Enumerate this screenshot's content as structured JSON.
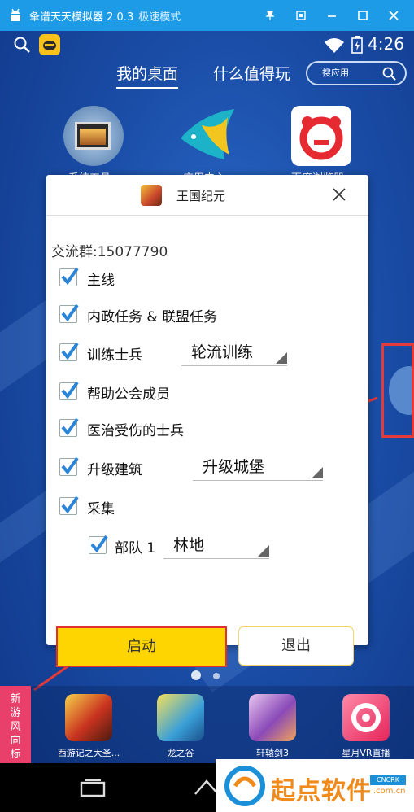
{
  "window": {
    "title": "夆谱天天模拟器 2.0.3",
    "mode": "极速模式",
    "controls": [
      "pin-icon",
      "restore-icon",
      "minimize-icon",
      "maximize-icon",
      "close-icon"
    ]
  },
  "statusbar": {
    "time": "4:26"
  },
  "tabs": [
    {
      "label": "我的桌面",
      "active": true
    },
    {
      "label": "什么值得玩",
      "active": false
    }
  ],
  "search": {
    "placeholder": "搜应用"
  },
  "desktop_apps": [
    {
      "label": "系统工具"
    },
    {
      "label": "应用中心"
    },
    {
      "label": "百度浏览器"
    }
  ],
  "dialog": {
    "title": "王国纪元",
    "group": "交流群:15077790",
    "options": [
      {
        "label": "主线",
        "checked": true
      },
      {
        "label": "内政任务 & 联盟任务",
        "checked": true
      },
      {
        "label": "训练士兵",
        "checked": true,
        "select": "轮流训练"
      },
      {
        "label": "帮助公会成员",
        "checked": true
      },
      {
        "label": "医治受伤的士兵",
        "checked": true
      },
      {
        "label": "升级建筑",
        "checked": true,
        "select": "升级城堡"
      },
      {
        "label": "采集",
        "checked": true
      }
    ],
    "sub_option": {
      "label": "部队 1",
      "checked": true,
      "select": "林地"
    },
    "start": "启动",
    "exit": "退出"
  },
  "dock": {
    "new_game_label": "新游风向标",
    "apps": [
      {
        "label": "西游记之大圣..."
      },
      {
        "label": "龙之谷"
      },
      {
        "label": "轩辕剑3"
      },
      {
        "label": "星月VR直播"
      }
    ]
  },
  "watermark": {
    "text": "起点软件",
    "badge": "CNCRK",
    "suffix": ".com.cn"
  },
  "colors": {
    "titlebar": "#1e9be6",
    "start_button": "#ffd500",
    "highlight_box": "#e53a3a",
    "new_game": "#e8406a"
  }
}
